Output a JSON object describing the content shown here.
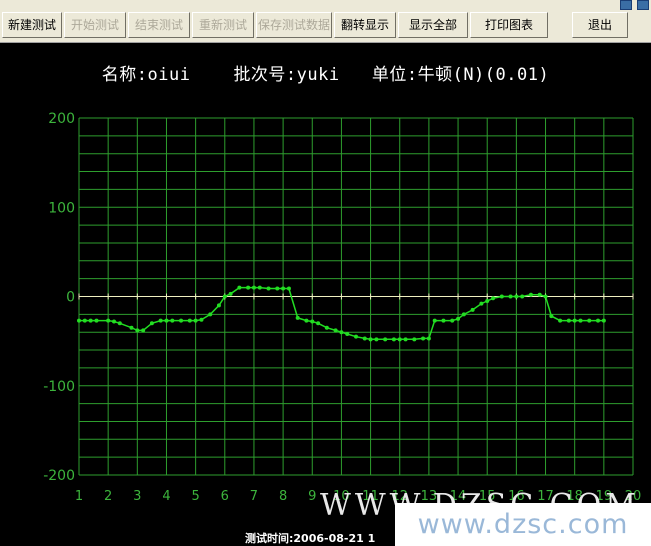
{
  "toolbar": {
    "buttons": [
      {
        "label": "新建测试",
        "enabled": true
      },
      {
        "label": "开始测试",
        "enabled": false
      },
      {
        "label": "结束测试",
        "enabled": false
      },
      {
        "label": "重新测试",
        "enabled": false
      },
      {
        "label": "保存测试数据",
        "enabled": false
      },
      {
        "label": "翻转显示",
        "enabled": true
      },
      {
        "label": "显示全部",
        "enabled": true
      },
      {
        "label": "打印图表",
        "enabled": true
      },
      {
        "label": "退出",
        "enabled": true
      }
    ]
  },
  "header": {
    "name_label": "名称:oiui",
    "batch_label": "批次号:yuki",
    "unit_label": "单位:牛顿(N)(0.01)"
  },
  "footer": {
    "test_time": "测试时间:2006-08-21 1"
  },
  "watermark": {
    "text": "www.dzsc.com",
    "ghost_text": "WWW.DZSC.COM"
  },
  "colors": {
    "background": "#000000",
    "grid": "#2e9e2e",
    "axis_text": "#3cb43c",
    "line": "#22dd22",
    "zero_line": "#f0f0c0"
  },
  "chart_data": {
    "type": "line",
    "title": "",
    "xlabel": "",
    "ylabel": "",
    "xlim": [
      1,
      20
    ],
    "ylim": [
      -200,
      200
    ],
    "xticks": [
      "1",
      "2",
      "3",
      "4",
      "5",
      "6",
      "7",
      "8",
      "9",
      "10",
      "11",
      "12",
      "13",
      "14",
      "15",
      "16",
      "17",
      "18",
      "19",
      "20"
    ],
    "yticks": [
      "200",
      "100",
      "0",
      "-100",
      "-200"
    ],
    "grid": true,
    "series": [
      {
        "name": "",
        "x": [
          1.0,
          1.2,
          1.4,
          1.6,
          2.0,
          2.2,
          2.4,
          2.8,
          3.0,
          3.2,
          3.5,
          3.8,
          4.0,
          4.2,
          4.5,
          4.8,
          5.0,
          5.2,
          5.5,
          5.8,
          6.0,
          6.2,
          6.5,
          6.8,
          7.0,
          7.2,
          7.5,
          7.8,
          8.0,
          8.2,
          8.5,
          8.8,
          9.0,
          9.2,
          9.5,
          9.8,
          10.0,
          10.2,
          10.5,
          10.8,
          11.0,
          11.2,
          11.5,
          11.8,
          12.0,
          12.2,
          12.5,
          12.8,
          13.0,
          13.2,
          13.5,
          13.8,
          14.0,
          14.2,
          14.5,
          14.8,
          15.0,
          15.2,
          15.5,
          15.8,
          16.0,
          16.2,
          16.5,
          16.8,
          17.0,
          17.2,
          17.5,
          17.8,
          18.0,
          18.2,
          18.5,
          18.8,
          19.0
        ],
        "y": [
          -27,
          -27,
          -27,
          -27,
          -27,
          -28,
          -30,
          -35,
          -38,
          -38,
          -30,
          -27,
          -27,
          -27,
          -27,
          -27,
          -27,
          -26,
          -20,
          -10,
          0,
          3,
          10,
          10,
          10,
          10,
          9,
          9,
          9,
          9,
          -24,
          -27,
          -28,
          -30,
          -35,
          -38,
          -40,
          -42,
          -45,
          -47,
          -48,
          -48,
          -48,
          -48,
          -48,
          -48,
          -48,
          -47,
          -47,
          -27,
          -27,
          -27,
          -25,
          -20,
          -15,
          -8,
          -5,
          -2,
          0,
          0,
          0,
          0,
          2,
          2,
          0,
          -22,
          -27,
          -27,
          -27,
          -27,
          -27,
          -27,
          -27
        ]
      }
    ]
  }
}
